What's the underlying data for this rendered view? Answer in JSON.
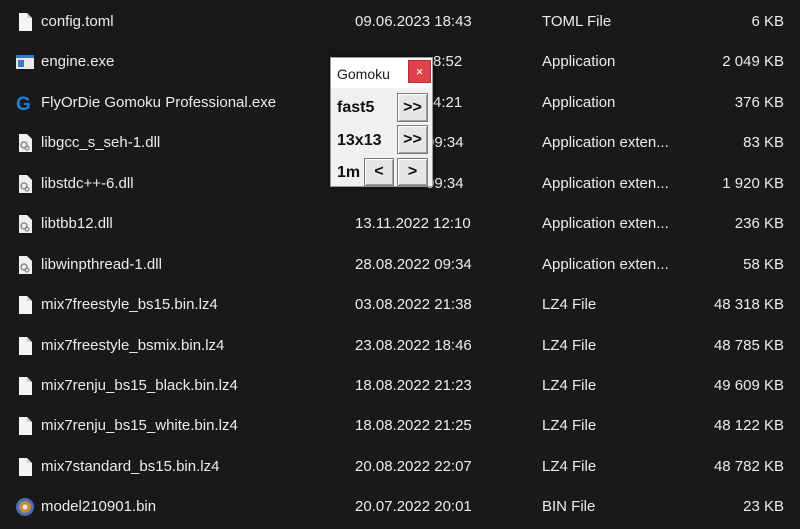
{
  "files": [
    {
      "name": "config.toml",
      "date": "09.06.2023 18:43",
      "type": "TOML File",
      "size": "6 KB",
      "icon": "document-icon"
    },
    {
      "name": "engine.exe",
      "date": "8:52",
      "type": "Application",
      "size": "2 049 KB",
      "icon": "exe-icon"
    },
    {
      "name": "FlyOrDie Gomoku Professional.exe",
      "date": "4:21",
      "type": "Application",
      "size": "376 KB",
      "icon": "gomoku-app-icon"
    },
    {
      "name": "libgcc_s_seh-1.dll",
      "date": "09:34",
      "type": "Application exten...",
      "size": "83 KB",
      "icon": "dll-icon"
    },
    {
      "name": "libstdc++-6.dll",
      "date": "09:34",
      "type": "Application exten...",
      "size": "1 920 KB",
      "icon": "dll-icon"
    },
    {
      "name": "libtbb12.dll",
      "date": "13.11.2022 12:10",
      "type": "Application exten...",
      "size": "236 KB",
      "icon": "dll-icon"
    },
    {
      "name": "libwinpthread-1.dll",
      "date": "28.08.2022 09:34",
      "type": "Application exten...",
      "size": "58 KB",
      "icon": "dll-icon"
    },
    {
      "name": "mix7freestyle_bs15.bin.lz4",
      "date": "03.08.2022 21:38",
      "type": "LZ4 File",
      "size": "48 318 KB",
      "icon": "document-icon"
    },
    {
      "name": "mix7freestyle_bsmix.bin.lz4",
      "date": "23.08.2022 18:46",
      "type": "LZ4 File",
      "size": "48 785 KB",
      "icon": "document-icon"
    },
    {
      "name": "mix7renju_bs15_black.bin.lz4",
      "date": "18.08.2022 21:23",
      "type": "LZ4 File",
      "size": "49 609 KB",
      "icon": "document-icon"
    },
    {
      "name": "mix7renju_bs15_white.bin.lz4",
      "date": "18.08.2022 21:25",
      "type": "LZ4 File",
      "size": "48 122 KB",
      "icon": "document-icon"
    },
    {
      "name": "mix7standard_bs15.bin.lz4",
      "date": "20.08.2022 22:07",
      "type": "LZ4 File",
      "size": "48 782 KB",
      "icon": "document-icon"
    },
    {
      "name": "model210901.bin",
      "date": "20.07.2022 20:01",
      "type": "BIN File",
      "size": "23 KB",
      "icon": "bin-media-icon"
    }
  ],
  "gomoku": {
    "title": "Gomoku",
    "close_label": "×",
    "rule_value": "fast5",
    "rule_next_label": ">>",
    "board_value": "13x13",
    "board_next_label": ">>",
    "time_value": "1m",
    "time_prev_label": "<",
    "time_next_label": ">"
  },
  "colors": {
    "background": "#191919",
    "text": "#ececec",
    "close_button": "#e0424a",
    "gomoku_icon": "#1e7fd6"
  }
}
